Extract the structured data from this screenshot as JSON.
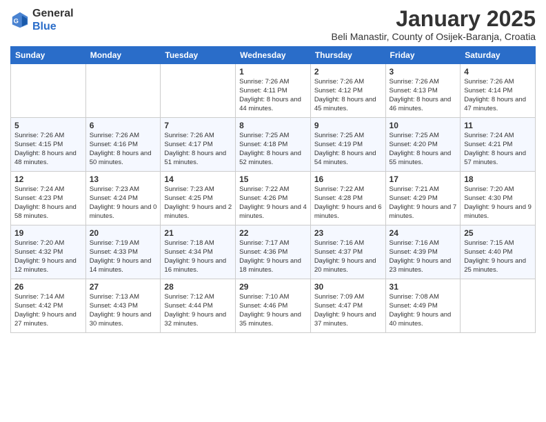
{
  "logo": {
    "general": "General",
    "blue": "Blue"
  },
  "header": {
    "month": "January 2025",
    "location": "Beli Manastir, County of Osijek-Baranja, Croatia"
  },
  "weekdays": [
    "Sunday",
    "Monday",
    "Tuesday",
    "Wednesday",
    "Thursday",
    "Friday",
    "Saturday"
  ],
  "weeks": [
    [
      {
        "day": "",
        "sunrise": "",
        "sunset": "",
        "daylight": ""
      },
      {
        "day": "",
        "sunrise": "",
        "sunset": "",
        "daylight": ""
      },
      {
        "day": "",
        "sunrise": "",
        "sunset": "",
        "daylight": ""
      },
      {
        "day": "1",
        "sunrise": "Sunrise: 7:26 AM",
        "sunset": "Sunset: 4:11 PM",
        "daylight": "Daylight: 8 hours and 44 minutes."
      },
      {
        "day": "2",
        "sunrise": "Sunrise: 7:26 AM",
        "sunset": "Sunset: 4:12 PM",
        "daylight": "Daylight: 8 hours and 45 minutes."
      },
      {
        "day": "3",
        "sunrise": "Sunrise: 7:26 AM",
        "sunset": "Sunset: 4:13 PM",
        "daylight": "Daylight: 8 hours and 46 minutes."
      },
      {
        "day": "4",
        "sunrise": "Sunrise: 7:26 AM",
        "sunset": "Sunset: 4:14 PM",
        "daylight": "Daylight: 8 hours and 47 minutes."
      }
    ],
    [
      {
        "day": "5",
        "sunrise": "Sunrise: 7:26 AM",
        "sunset": "Sunset: 4:15 PM",
        "daylight": "Daylight: 8 hours and 48 minutes."
      },
      {
        "day": "6",
        "sunrise": "Sunrise: 7:26 AM",
        "sunset": "Sunset: 4:16 PM",
        "daylight": "Daylight: 8 hours and 50 minutes."
      },
      {
        "day": "7",
        "sunrise": "Sunrise: 7:26 AM",
        "sunset": "Sunset: 4:17 PM",
        "daylight": "Daylight: 8 hours and 51 minutes."
      },
      {
        "day": "8",
        "sunrise": "Sunrise: 7:25 AM",
        "sunset": "Sunset: 4:18 PM",
        "daylight": "Daylight: 8 hours and 52 minutes."
      },
      {
        "day": "9",
        "sunrise": "Sunrise: 7:25 AM",
        "sunset": "Sunset: 4:19 PM",
        "daylight": "Daylight: 8 hours and 54 minutes."
      },
      {
        "day": "10",
        "sunrise": "Sunrise: 7:25 AM",
        "sunset": "Sunset: 4:20 PM",
        "daylight": "Daylight: 8 hours and 55 minutes."
      },
      {
        "day": "11",
        "sunrise": "Sunrise: 7:24 AM",
        "sunset": "Sunset: 4:21 PM",
        "daylight": "Daylight: 8 hours and 57 minutes."
      }
    ],
    [
      {
        "day": "12",
        "sunrise": "Sunrise: 7:24 AM",
        "sunset": "Sunset: 4:23 PM",
        "daylight": "Daylight: 8 hours and 58 minutes."
      },
      {
        "day": "13",
        "sunrise": "Sunrise: 7:23 AM",
        "sunset": "Sunset: 4:24 PM",
        "daylight": "Daylight: 9 hours and 0 minutes."
      },
      {
        "day": "14",
        "sunrise": "Sunrise: 7:23 AM",
        "sunset": "Sunset: 4:25 PM",
        "daylight": "Daylight: 9 hours and 2 minutes."
      },
      {
        "day": "15",
        "sunrise": "Sunrise: 7:22 AM",
        "sunset": "Sunset: 4:26 PM",
        "daylight": "Daylight: 9 hours and 4 minutes."
      },
      {
        "day": "16",
        "sunrise": "Sunrise: 7:22 AM",
        "sunset": "Sunset: 4:28 PM",
        "daylight": "Daylight: 9 hours and 6 minutes."
      },
      {
        "day": "17",
        "sunrise": "Sunrise: 7:21 AM",
        "sunset": "Sunset: 4:29 PM",
        "daylight": "Daylight: 9 hours and 7 minutes."
      },
      {
        "day": "18",
        "sunrise": "Sunrise: 7:20 AM",
        "sunset": "Sunset: 4:30 PM",
        "daylight": "Daylight: 9 hours and 9 minutes."
      }
    ],
    [
      {
        "day": "19",
        "sunrise": "Sunrise: 7:20 AM",
        "sunset": "Sunset: 4:32 PM",
        "daylight": "Daylight: 9 hours and 12 minutes."
      },
      {
        "day": "20",
        "sunrise": "Sunrise: 7:19 AM",
        "sunset": "Sunset: 4:33 PM",
        "daylight": "Daylight: 9 hours and 14 minutes."
      },
      {
        "day": "21",
        "sunrise": "Sunrise: 7:18 AM",
        "sunset": "Sunset: 4:34 PM",
        "daylight": "Daylight: 9 hours and 16 minutes."
      },
      {
        "day": "22",
        "sunrise": "Sunrise: 7:17 AM",
        "sunset": "Sunset: 4:36 PM",
        "daylight": "Daylight: 9 hours and 18 minutes."
      },
      {
        "day": "23",
        "sunrise": "Sunrise: 7:16 AM",
        "sunset": "Sunset: 4:37 PM",
        "daylight": "Daylight: 9 hours and 20 minutes."
      },
      {
        "day": "24",
        "sunrise": "Sunrise: 7:16 AM",
        "sunset": "Sunset: 4:39 PM",
        "daylight": "Daylight: 9 hours and 23 minutes."
      },
      {
        "day": "25",
        "sunrise": "Sunrise: 7:15 AM",
        "sunset": "Sunset: 4:40 PM",
        "daylight": "Daylight: 9 hours and 25 minutes."
      }
    ],
    [
      {
        "day": "26",
        "sunrise": "Sunrise: 7:14 AM",
        "sunset": "Sunset: 4:42 PM",
        "daylight": "Daylight: 9 hours and 27 minutes."
      },
      {
        "day": "27",
        "sunrise": "Sunrise: 7:13 AM",
        "sunset": "Sunset: 4:43 PM",
        "daylight": "Daylight: 9 hours and 30 minutes."
      },
      {
        "day": "28",
        "sunrise": "Sunrise: 7:12 AM",
        "sunset": "Sunset: 4:44 PM",
        "daylight": "Daylight: 9 hours and 32 minutes."
      },
      {
        "day": "29",
        "sunrise": "Sunrise: 7:10 AM",
        "sunset": "Sunset: 4:46 PM",
        "daylight": "Daylight: 9 hours and 35 minutes."
      },
      {
        "day": "30",
        "sunrise": "Sunrise: 7:09 AM",
        "sunset": "Sunset: 4:47 PM",
        "daylight": "Daylight: 9 hours and 37 minutes."
      },
      {
        "day": "31",
        "sunrise": "Sunrise: 7:08 AM",
        "sunset": "Sunset: 4:49 PM",
        "daylight": "Daylight: 9 hours and 40 minutes."
      },
      {
        "day": "",
        "sunrise": "",
        "sunset": "",
        "daylight": ""
      }
    ]
  ]
}
